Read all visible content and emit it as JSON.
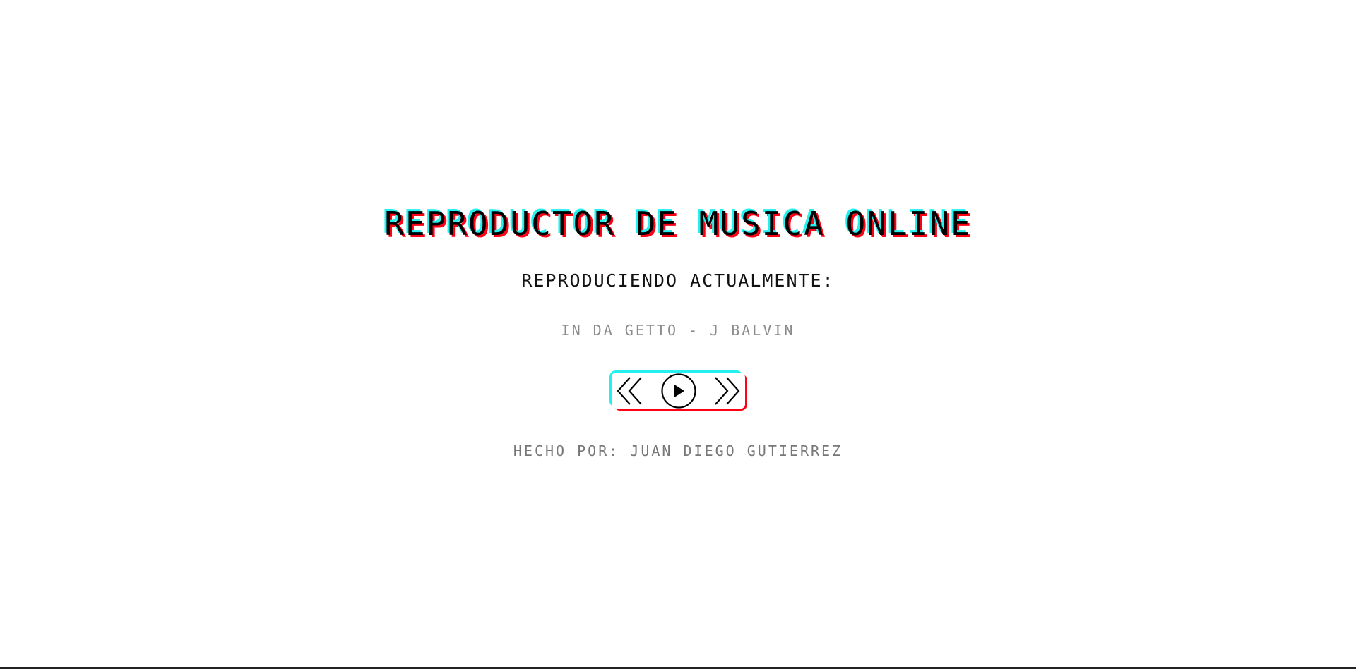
{
  "header": {
    "title": "REPRODUCTOR DE MUSICA ONLINE"
  },
  "player": {
    "now_playing_label": "REPRODUCIENDO ACTUALMENTE:",
    "current_song": "IN DA GETTO - J BALVIN",
    "controls": {
      "previous_icon": "double-chevron-left-icon",
      "play_icon": "play-circle-icon",
      "next_icon": "double-chevron-right-icon"
    }
  },
  "footer": {
    "credit": "HECHO POR: JUAN DIEGO GUTIERREZ"
  },
  "colors": {
    "accent_cyan": "#25f0f0",
    "accent_red": "#ff0015",
    "text": "#000000",
    "muted_text": "#8b8b8b",
    "background": "#ffffff"
  }
}
